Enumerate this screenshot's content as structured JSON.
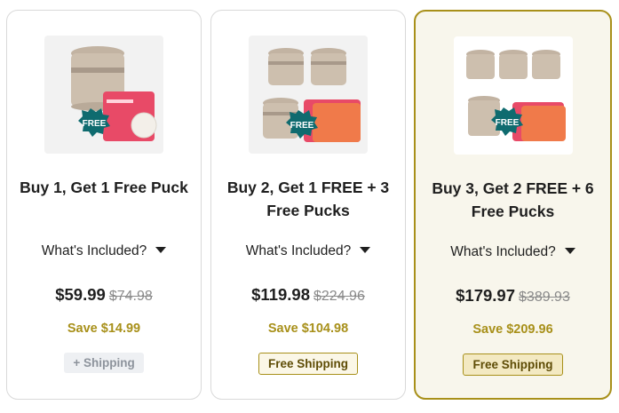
{
  "colors": {
    "accent": "#a8901a",
    "selected_bg": "#f8f6ec",
    "badge": "#0f6b6f"
  },
  "cards": [
    {
      "title": "Buy 1, Get 1 Free Puck",
      "included": "What's Included?",
      "price": "$59.99",
      "old_price": "$74.98",
      "save": "Save $14.99",
      "shipping": "+ Shipping",
      "badge": "FREE",
      "product_icon": "speaker-device-with-pucks"
    },
    {
      "title": "Buy 2, Get 1 FREE + 3 Free Pucks",
      "included": "What's Included?",
      "price": "$119.98",
      "old_price": "$224.96",
      "save": "Save $104.98",
      "shipping": "Free Shipping",
      "badge": "FREE",
      "product_icon": "three-devices-with-pucks"
    },
    {
      "title": "Buy 3, Get 2 FREE + 6 Free Pucks",
      "included": "What's Included?",
      "price": "$179.97",
      "old_price": "$389.93",
      "save": "Save $209.96",
      "shipping": "Free Shipping",
      "badge": "FREE",
      "product_icon": "five-devices-with-pucks"
    }
  ]
}
